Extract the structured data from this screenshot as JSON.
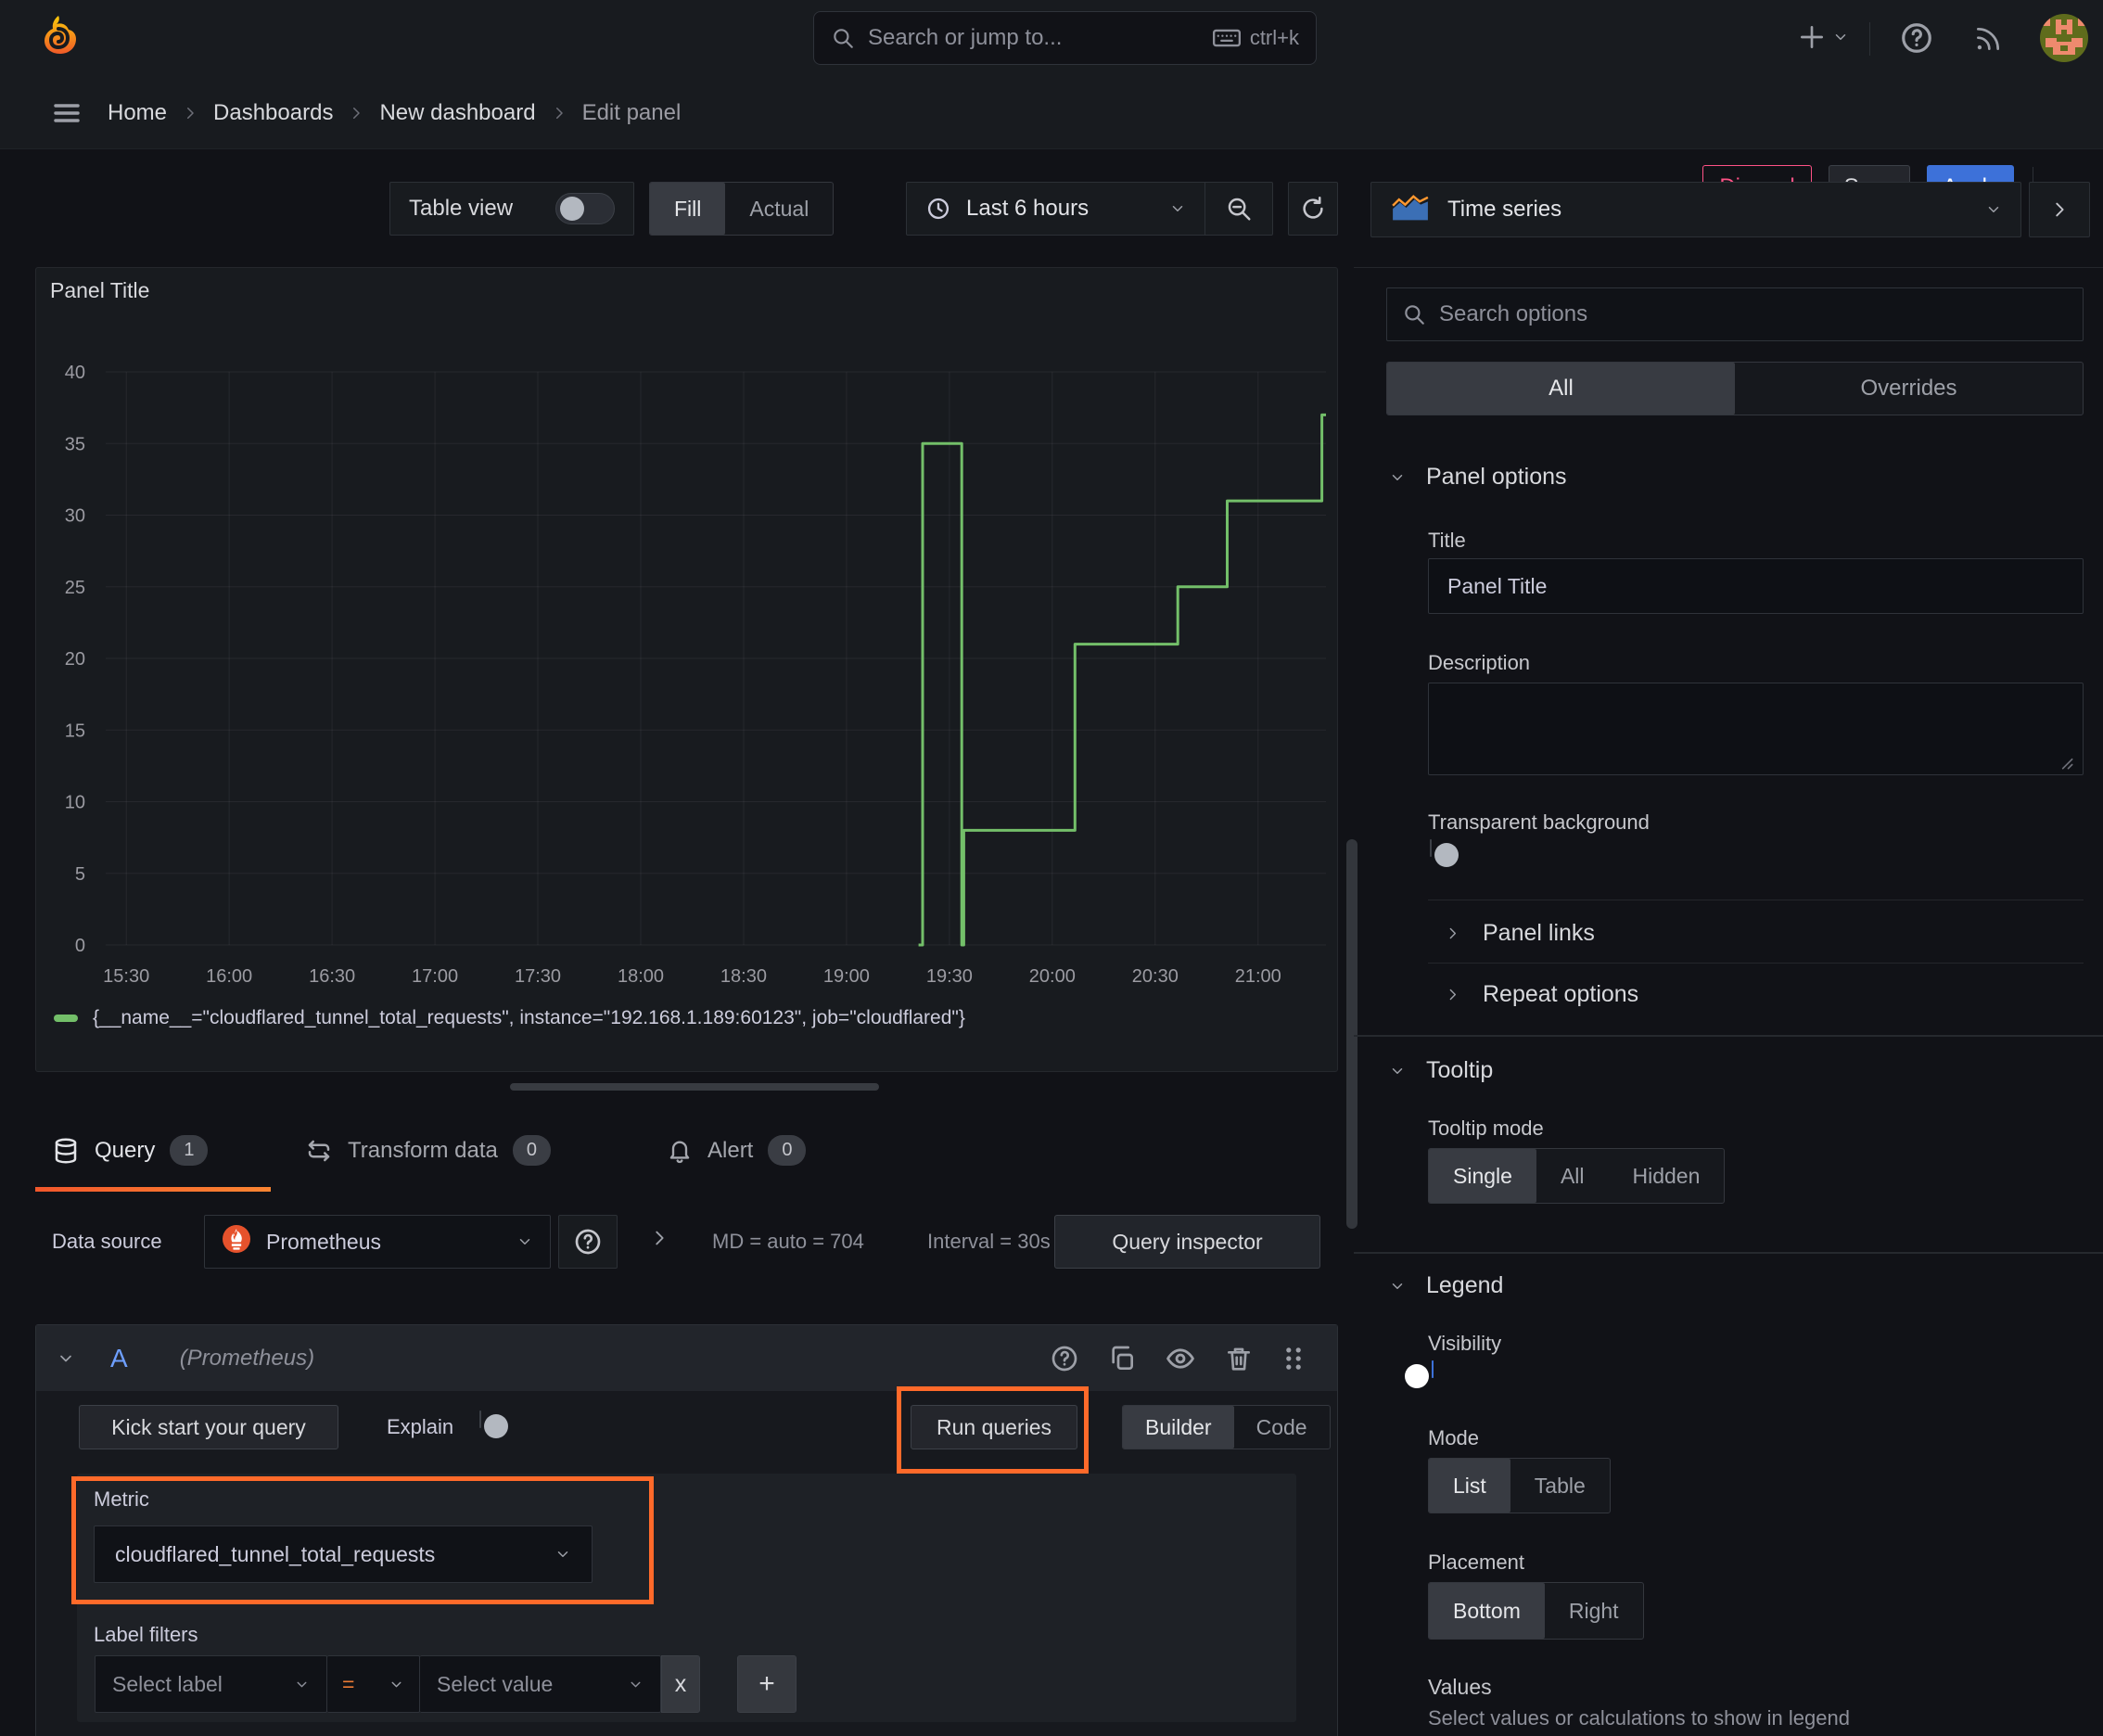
{
  "topnav": {
    "search_placeholder": "Search or jump to...",
    "search_shortcut": "ctrl+k"
  },
  "breadcrumb": {
    "items": [
      "Home",
      "Dashboards",
      "New dashboard",
      "Edit panel"
    ],
    "discard": "Discard",
    "save": "Save",
    "apply": "Apply"
  },
  "toolbar": {
    "table_view": "Table view",
    "fill": "Fill",
    "actual": "Actual",
    "time_range": "Last 6 hours"
  },
  "panel": {
    "title": "Panel Title"
  },
  "chart_data": {
    "type": "line",
    "title": "Panel Title",
    "xlabel": "",
    "ylabel": "",
    "grid": true,
    "legend_position": "bottom",
    "ylim": [
      0,
      40
    ],
    "y_ticks": [
      0,
      5,
      10,
      15,
      20,
      25,
      30,
      35,
      40
    ],
    "xlim_hours": [
      15.4,
      21.33
    ],
    "x_ticks": [
      "15:30",
      "16:00",
      "16:30",
      "17:00",
      "17:30",
      "18:00",
      "18:30",
      "19:00",
      "19:30",
      "20:00",
      "20:30",
      "21:00"
    ],
    "x_tick_hours": [
      15.5,
      16,
      16.5,
      17,
      17.5,
      18,
      18.5,
      19,
      19.5,
      20,
      20.5,
      21
    ],
    "series": [
      {
        "name": "{__name__=\"cloudflared_tunnel_total_requests\", instance=\"192.168.1.189:60123\", job=\"cloudflared\"}",
        "color": "#73bf69",
        "points_hours_value": [
          [
            19.35,
            0
          ],
          [
            19.37,
            0
          ],
          [
            19.37,
            35
          ],
          [
            19.56,
            35
          ],
          [
            19.56,
            0
          ],
          [
            19.57,
            0
          ],
          [
            19.57,
            8
          ],
          [
            20.11,
            8
          ],
          [
            20.11,
            21
          ],
          [
            20.61,
            21
          ],
          [
            20.61,
            25
          ],
          [
            20.85,
            25
          ],
          [
            20.85,
            31
          ],
          [
            21.31,
            31
          ],
          [
            21.31,
            37
          ],
          [
            21.33,
            37
          ]
        ]
      }
    ]
  },
  "tabs": {
    "query": {
      "label": "Query",
      "count": "1"
    },
    "transform": {
      "label": "Transform data",
      "count": "0"
    },
    "alert": {
      "label": "Alert",
      "count": "0"
    }
  },
  "query_editor": {
    "datasource_label": "Data source",
    "datasource": "Prometheus",
    "stats_md": "MD = auto = 704",
    "stats_interval": "Interval = 30s",
    "query_inspector": "Query inspector",
    "ref_id": "A",
    "ref_source": "(Prometheus)",
    "kick_start": "Kick start your query",
    "explain": "Explain",
    "run_queries": "Run queries",
    "builder": "Builder",
    "code": "Code",
    "metric_label": "Metric",
    "metric_value": "cloudflared_tunnel_total_requests",
    "label_filters_label": "Label filters",
    "select_label": "Select label",
    "operator": "=",
    "select_value": "Select value",
    "remove_filter": "x",
    "add_filter": "+"
  },
  "options_pane": {
    "visualization": "Time series",
    "search_placeholder": "Search options",
    "tab_all": "All",
    "tab_overrides": "Overrides",
    "panel_options": {
      "title": "Panel options",
      "title_label": "Title",
      "title_value": "Panel Title",
      "description_label": "Description",
      "transparent_label": "Transparent background"
    },
    "panel_links": "Panel links",
    "repeat_options": "Repeat options",
    "tooltip": {
      "title": "Tooltip",
      "mode_label": "Tooltip mode",
      "modes": [
        "Single",
        "All",
        "Hidden"
      ],
      "selected": "Single"
    },
    "legend": {
      "title": "Legend",
      "visibility_label": "Visibility",
      "mode_label": "Mode",
      "modes": [
        "List",
        "Table"
      ],
      "selected_mode": "List",
      "placement_label": "Placement",
      "placements": [
        "Bottom",
        "Right"
      ],
      "selected_placement": "Bottom",
      "values_label": "Values",
      "values_hint": "Select values or calculations to show in legend"
    }
  },
  "colors": {
    "accent_blue": "#3d71d9",
    "series_green": "#73bf69",
    "annotation_orange": "#ff6a2a",
    "discard_pink": "#ff5286",
    "refid_blue": "#6e9fff",
    "prometheus_orange": "#e6522c",
    "tab_active_gradient_start": "#f2572b",
    "tab_active_gradient_end": "#fb8532"
  }
}
